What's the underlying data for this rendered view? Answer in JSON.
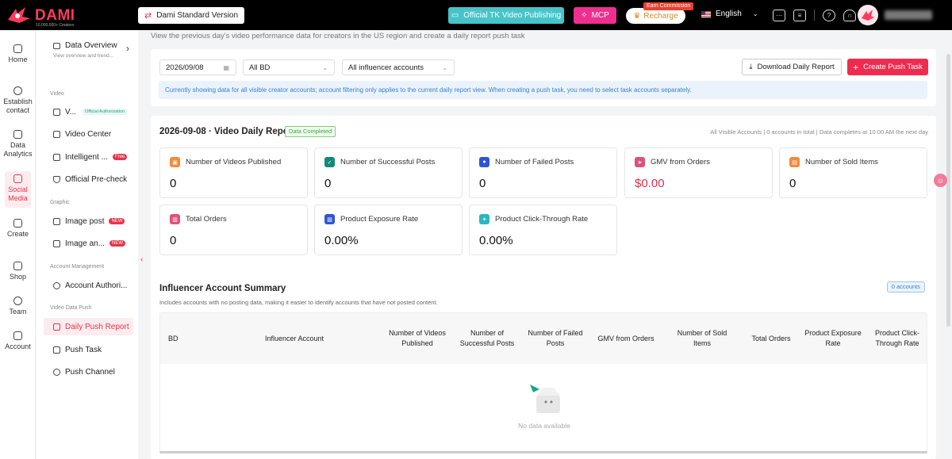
{
  "topbar": {
    "logo": "DAMI",
    "logo_sub": "10,000,000+ Creators",
    "version": "Dami Standard Version",
    "tk_button": "Official TK Video Publishing",
    "mcp_button": "MCP",
    "recharge_button": "Recharge",
    "earn_badge": "Earn Commission",
    "language": "English"
  },
  "rail": [
    {
      "label": "Home"
    },
    {
      "label": "Establish contact"
    },
    {
      "label": "Data Analytics"
    },
    {
      "label": "Social Media"
    },
    {
      "label": "Create"
    },
    {
      "label": "Shop"
    },
    {
      "label": "Team"
    },
    {
      "label": "Account"
    }
  ],
  "sidebar": {
    "overview_title": "Data Overview",
    "overview_sub": "View overview and trend...",
    "sec_video": "Video",
    "video_item": "V...",
    "official_auth": "Official Authorization",
    "video_center": "Video Center",
    "intelligent": "Intelligent ...",
    "free_tag": "Free",
    "precheck": "Official Pre-check",
    "sec_graphic": "Graphic",
    "image_post": "Image post",
    "image_an": "Image an...",
    "new_tag": "NEW",
    "sec_account": "Account Management",
    "account_auth": "Account Authori...",
    "sec_push": "Video Data Push",
    "daily_push": "Daily Push Report",
    "push_task": "Push Task",
    "push_channel": "Push Channel"
  },
  "main": {
    "intro": "View the previous day's video performance data for creators in the US region and create a daily report push task",
    "date": "2026/09/08",
    "bd_select": "All BD",
    "account_select": "All influencer accounts",
    "download": "Download Daily Report",
    "create": "Create Push Task",
    "info": "Currently showing data for all visible creator accounts; account filtering only applies to the current daily report view. When creating a push task, you need to select task accounts separately."
  },
  "report": {
    "title": "2026-09-08 · Video Daily Report",
    "status": "Data Completed",
    "meta": "All Visible Accounts | 0 accounts in total | Data completes at 10:00 AM the next day",
    "metrics": [
      {
        "label": "Number of Videos Published",
        "value": "0",
        "color": "#f58a3c"
      },
      {
        "label": "Number of Successful Posts",
        "value": "0",
        "color": "#138a76"
      },
      {
        "label": "Number of Failed Posts",
        "value": "0",
        "color": "#2f55d4"
      },
      {
        "label": "GMV from Orders",
        "value": "$0.00",
        "color": "#e0507a"
      },
      {
        "label": "Number of Sold Items",
        "value": "0",
        "color": "#f58a3c"
      },
      {
        "label": "Total Orders",
        "value": "0",
        "color": "#e0507a"
      },
      {
        "label": "Product Exposure Rate",
        "value": "0.00%",
        "color": "#2f55d4"
      },
      {
        "label": "Product Click-Through Rate",
        "value": "0.00%",
        "color": "#29b7c6"
      }
    ]
  },
  "summary": {
    "title": "Influencer Account Summary",
    "subtitle": "Includes accounts with no posting data, making it easier to identify accounts that have not posted content.",
    "badge": "0 accounts",
    "columns": [
      "BD",
      "Influencer Account",
      "Number of Videos Published",
      "Number of Successful Posts",
      "Number of Failed Posts",
      "GMV from Orders",
      "Number of Sold Items",
      "Total Orders",
      "Product Exposure Rate",
      "Product Click-Through Rate"
    ],
    "empty": "No data available"
  }
}
